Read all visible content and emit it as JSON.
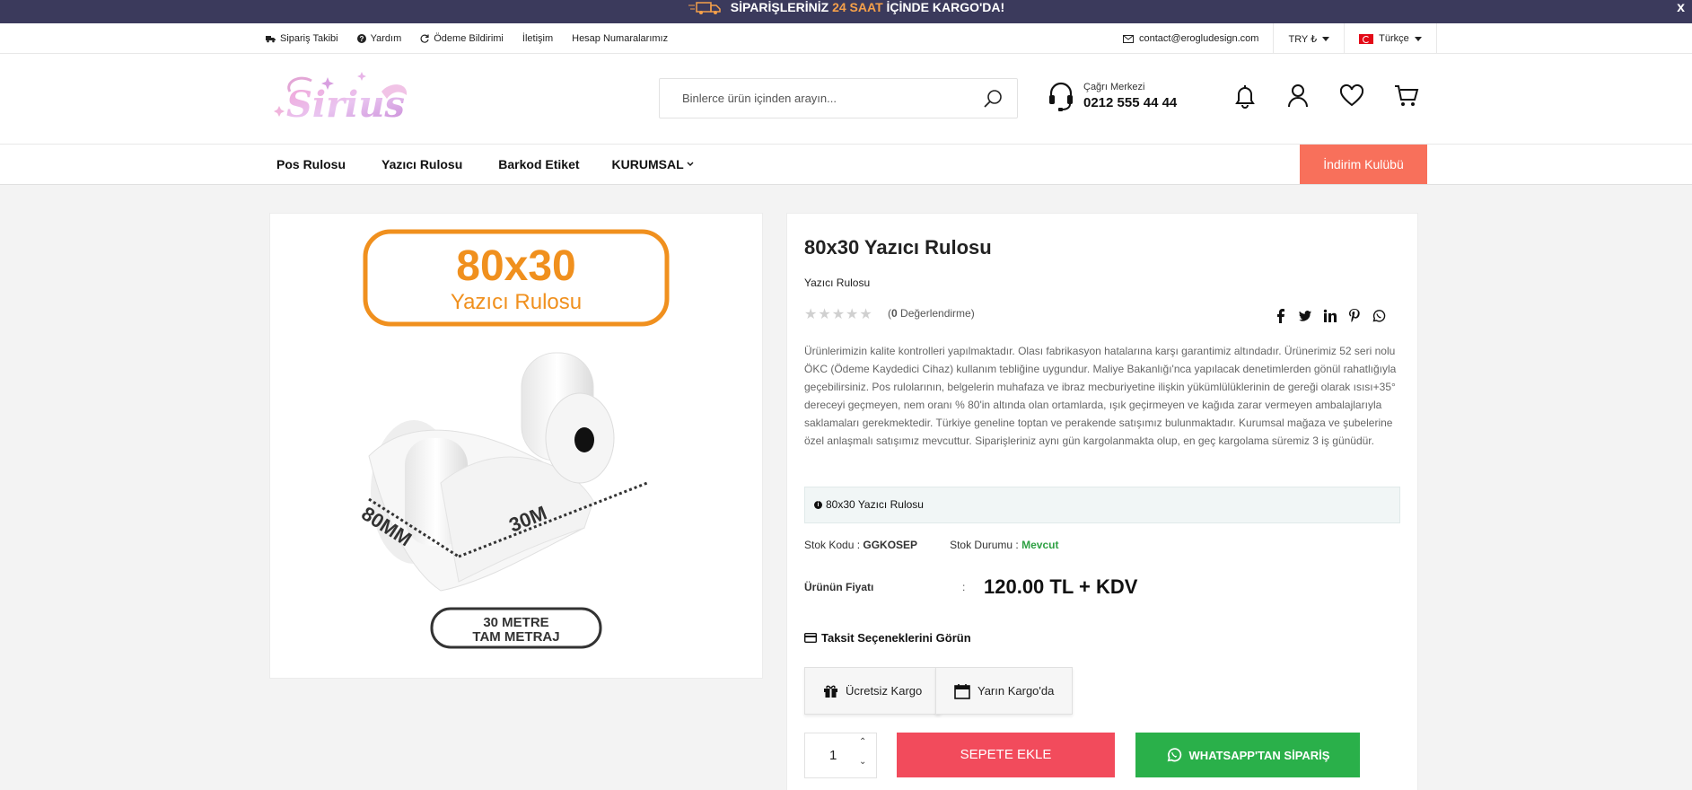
{
  "announcement": {
    "pre": "SİPARİŞLERİNİZ ",
    "highlight": "24 SAAT",
    "post": " İÇİNDE KARGO'DA!",
    "close": "x"
  },
  "topbar": {
    "links": [
      "Sipariş Takibi",
      "Yardım",
      "Ödeme Bildirimi",
      "İletişim",
      "Hesap Numaralarımız"
    ],
    "email": "contact@erogludesign.com",
    "currency": "TRY ₺",
    "language": "Türkçe"
  },
  "header": {
    "search_placeholder": "Binlerce ürün içinden arayın...",
    "call_label": "Çağrı Merkezi",
    "call_number": "0212 555 44 44"
  },
  "nav": {
    "items": [
      "Pos Rulosu",
      "Yazıcı Rulosu",
      "Barkod Etiket",
      "KURUMSAL"
    ],
    "club": "İndirim Kulübü"
  },
  "product_image": {
    "title": "80x30",
    "subtitle": "Yazıcı Rulosu",
    "dim_width": "80MM",
    "dim_length": "30M",
    "badge_line1": "30 METRE",
    "badge_line2": "TAM METRAJ"
  },
  "product": {
    "title": "80x30 Yazıcı Rulosu",
    "category": "Yazıcı Rulosu",
    "stars": "★★★★★",
    "reviews_pre": "(",
    "reviews_count": "0",
    "reviews_post": " Değerlendirme)",
    "description": "Ürünlerimizin kalite kontrolleri yapılmaktadır. Olası fabrikasyon hatalarına karşı garantimiz altındadır. Ürünerimiz 52 seri nolu ÖKC (Ödeme Kaydedici Cihaz) kullanım tebliğine uygundur. Maliye Bakanlığı'nca yapılacak denetimlerden gönül rahatlığıyla geçebilirsiniz. Pos rulolarının, belgelerin muhafaza ve ibraz mecburiyetine ilişkin yükümlülüklerinin de gereği olarak ısısı+35° dereceyi geçmeyen, nem oranı % 80'in altında olan ortamlarda, ışık geçirmeyen ve kağıda zarar vermeyen ambalajlarıyla saklamaları gerekmektedir. Türkiye geneline toptan ve perakende satışımız bulunmaktadır. Kurumsal mağaza ve şubelerine özel anlaşmalı satışımız mevcuttur. Siparişleriniz aynı gün kargolanmakta olup, en geç kargolama süremiz 3 iş günüdür.",
    "info": "80x30 Yazıcı Rulosu",
    "stock_code_label": "Stok Kodu : ",
    "stock_code": "GGKOSEP",
    "stock_status_label": "Stok Durumu : ",
    "stock_status": "Mevcut",
    "price_label": "Ürünün Fiyatı",
    "price_sep": ":",
    "price": "120.00 TL + KDV",
    "installment": "Taksit Seçeneklerini Görün",
    "badge_free_shipping": "Ücretsiz Kargo",
    "badge_tomorrow": "Yarın Kargo'da",
    "quantity": "1",
    "qty_up": "⌃",
    "qty_down": "⌄",
    "add_to_cart": "SEPETE EKLE",
    "whatsapp_order": "WHATSAPP'TAN SİPARİŞ"
  },
  "colors": {
    "announcement_bg": "#3b3a5c",
    "club_bg": "#f8705b",
    "cart_bg": "#f24b5c",
    "whatsapp_bg": "#2ab04a",
    "roll_accent": "#f0901e",
    "in_stock": "#2ea043"
  }
}
